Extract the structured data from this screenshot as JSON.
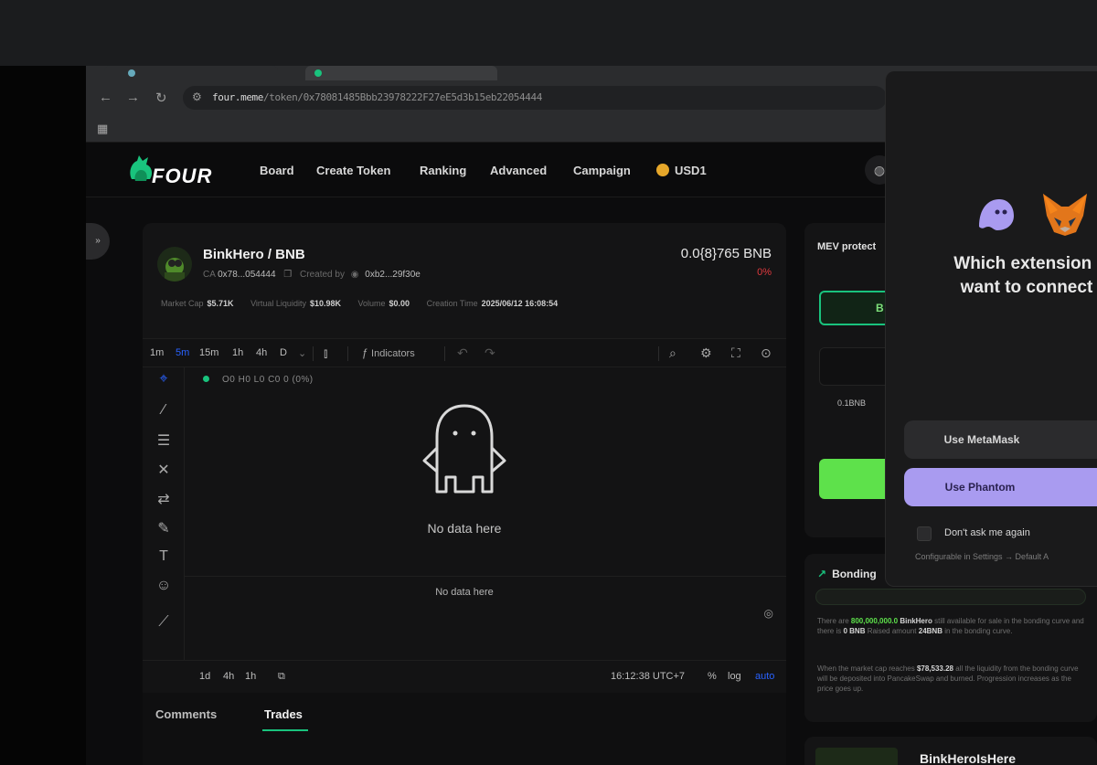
{
  "browser": {
    "url_host": "four.meme",
    "url_path": "/token/0x78081485Bbb23978222F27eE5d3b15eb22054444",
    "back_icon": "arrow-left-icon",
    "forward_icon": "arrow-right-icon",
    "reload_icon": "reload-icon"
  },
  "site": {
    "logo_text": "FOUR",
    "nav": [
      "Board",
      "Create Token",
      "Ranking",
      "Advanced",
      "Campaign"
    ],
    "currency": "USD1"
  },
  "token": {
    "pair": "BinkHero / BNB",
    "ca_label": "CA",
    "ca_value": "0x78...054444",
    "created_by_label": "Created by",
    "creator": "0xb2...29f30e",
    "price": "0.0{8}765 BNB",
    "change": "0%",
    "stats": [
      {
        "label": "Market Cap",
        "value": "$5.71K"
      },
      {
        "label": "Virtual Liquidity",
        "value": "$10.98K"
      },
      {
        "label": "Volume",
        "value": "$0.00"
      },
      {
        "label": "Creation Time",
        "value": "2025/06/12 16:08:54"
      }
    ]
  },
  "chart_toolbar": {
    "timeframes": [
      "1m",
      "5m",
      "15m",
      "1h",
      "4h",
      "D"
    ],
    "active_timeframe": "5m",
    "indicators_label": "Indicators"
  },
  "chart": {
    "ohlc": "O0 H0 L0 C0 0 (0%)",
    "no_data_main": "No data here",
    "no_data_sub": "No data here",
    "range_buttons": [
      "1d",
      "4h",
      "1h"
    ],
    "time": "16:12:38 UTC+7",
    "pct": "%",
    "log": "log",
    "auto": "auto"
  },
  "panel_tabs": [
    "Comments",
    "Trades"
  ],
  "trade": {
    "mev_label": "MEV protect",
    "buy_label": "B",
    "preset": "0.1BNB"
  },
  "bonding": {
    "title": "Bonding",
    "line1_a": "There are ",
    "amount": "800,000,000.0",
    "token": "BinkHero",
    "line1_b": " still available for sale in the bonding curve and there is ",
    "bnb": "0 BNB",
    "line1_c": " Raised amount ",
    "raised": "24BNB",
    "line1_d": " in the bonding curve.",
    "line2_a": "When the market cap reaches ",
    "target": "$78,533.28",
    "line2_b": " all the liquidity from the bonding curve will be deposited into PancakeSwap and burned. Progression increases as the price goes up.",
    "progress": 0.0
  },
  "promo": {
    "title": "BinkHeroIsHere"
  },
  "wallet_popup": {
    "question_line1": "Which extension do",
    "question_line2": "want to connect w",
    "metamask_label": "Use MetaMask",
    "phantom_label": "Use Phantom",
    "dont_ask_label": "Don't ask me again",
    "config_note": "Configurable in Settings → Default A"
  },
  "colors": {
    "accent_green": "#19c37d",
    "buy_green": "#5ee14b",
    "negative_red": "#e0393e",
    "tv_blue": "#2962ff",
    "phantom_purple": "#a99bf0",
    "coin_gold": "#e6a72a"
  }
}
